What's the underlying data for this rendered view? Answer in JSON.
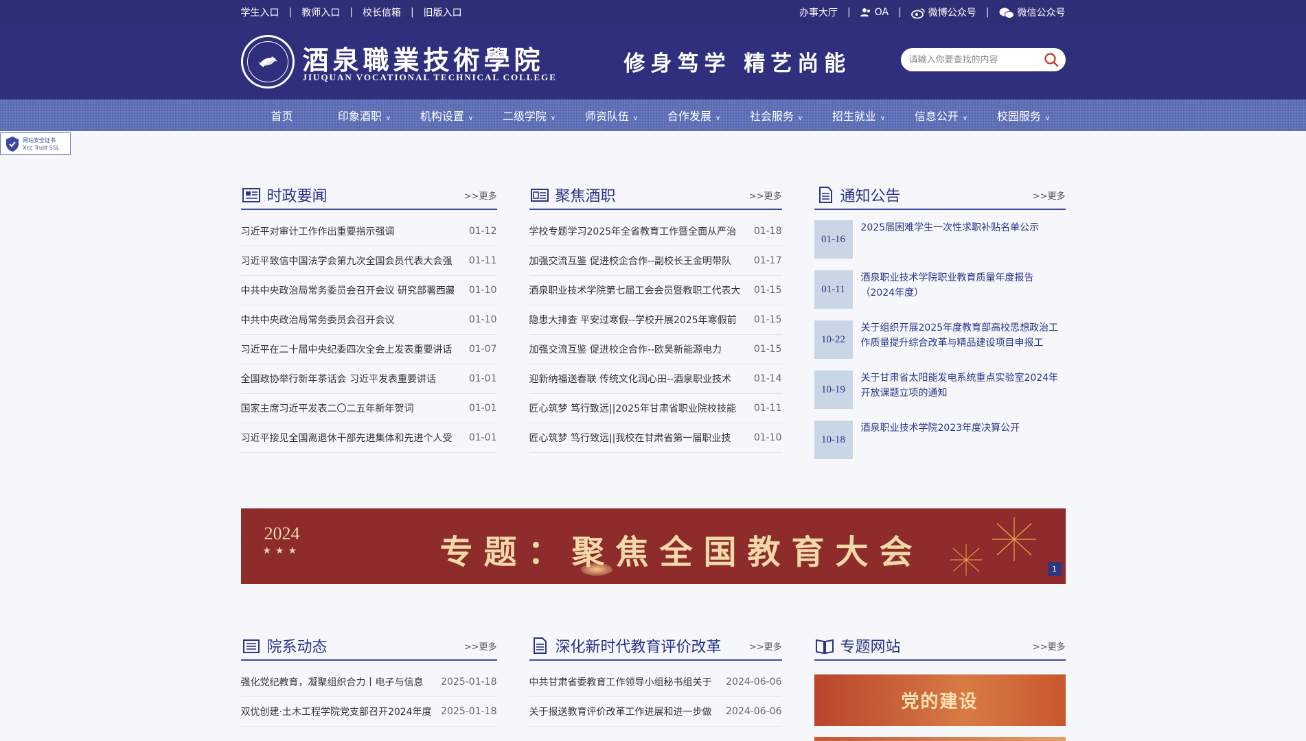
{
  "topbar": {
    "left": [
      "学生入口",
      "教师入口",
      "校长信箱",
      "旧版入口"
    ],
    "right": [
      "办事大厅",
      "OA",
      "微博公众号",
      "微信公众号"
    ]
  },
  "header": {
    "school_cn": "酒泉職業技術學院",
    "school_en": "JIUQUAN VOCATIONAL TECHNICAL COLLEGE",
    "motto": "修身笃学  精艺尚能",
    "search_placeholder": "请输入你要查找的内容"
  },
  "nav": [
    {
      "label": "首页",
      "dropdown": false
    },
    {
      "label": "印象酒职",
      "dropdown": true
    },
    {
      "label": "机构设置",
      "dropdown": true
    },
    {
      "label": "二级学院",
      "dropdown": true
    },
    {
      "label": "师资队伍",
      "dropdown": true
    },
    {
      "label": "合作发展",
      "dropdown": true
    },
    {
      "label": "社会服务",
      "dropdown": true
    },
    {
      "label": "招生就业",
      "dropdown": true
    },
    {
      "label": "信息公开",
      "dropdown": true
    },
    {
      "label": "校园服务",
      "dropdown": true
    }
  ],
  "ssl_badge": {
    "line1": "网站安全证书",
    "line2": "Xcc Trust SSL"
  },
  "more_label": ">>更多",
  "sections": {
    "politics": {
      "title": "时政要闻",
      "items": [
        {
          "title": "习近平对审计工作作出重要指示强调",
          "date": "01-12"
        },
        {
          "title": "习近平致信中国法学会第九次全国会员代表大会强",
          "date": "01-11"
        },
        {
          "title": "中共中央政治局常务委员会召开会议 研究部署西藏",
          "date": "01-10"
        },
        {
          "title": "中共中央政治局常务委员会召开会议",
          "date": "01-10"
        },
        {
          "title": "习近平在二十届中央纪委四次全会上发表重要讲话",
          "date": "01-07"
        },
        {
          "title": "全国政协举行新年茶话会 习近平发表重要讲话",
          "date": "01-01"
        },
        {
          "title": "国家主席习近平发表二〇二五年新年贺词",
          "date": "01-01"
        },
        {
          "title": "习近平接见全国离退休干部先进集体和先进个人受",
          "date": "01-01"
        }
      ]
    },
    "focus": {
      "title": "聚焦酒职",
      "items": [
        {
          "title": "学校专题学习2025年全省教育工作暨全面从严治",
          "date": "01-18"
        },
        {
          "title": "加强交流互鉴 促进校企合作--副校长王金明带队",
          "date": "01-17"
        },
        {
          "title": "酒泉职业技术学院第七届工会会员暨教职工代表大",
          "date": "01-15"
        },
        {
          "title": "隐患大排查 平安过寒假--学校开展2025年寒假前",
          "date": "01-15"
        },
        {
          "title": "加强交流互鉴 促进校企合作--欧昊新能源电力",
          "date": "01-15"
        },
        {
          "title": "迎新纳福送春联 传统文化润心田--酒泉职业技术",
          "date": "01-14"
        },
        {
          "title": "匠心筑梦 笃行致远||2025年甘肃省职业院校技能",
          "date": "01-11"
        },
        {
          "title": "匠心筑梦 笃行致远||我校在甘肃省第一届职业技",
          "date": "01-10"
        }
      ]
    },
    "notices": {
      "title": "通知公告",
      "items": [
        {
          "date": "01-16",
          "title": "2025届困难学生一次性求职补贴名单公示"
        },
        {
          "date": "01-11",
          "title": "酒泉职业技术学院职业教育质量年度报告（2024年度）"
        },
        {
          "date": "10-22",
          "title": "关于组织开展2025年度教育部高校思想政治工作质量提升综合改革与精品建设项目申报工"
        },
        {
          "date": "10-19",
          "title": "关于甘肃省太阳能发电系统重点实验室2024年开放课题立项的通知"
        },
        {
          "date": "10-18",
          "title": "酒泉职业技术学院2023年度决算公开"
        }
      ]
    },
    "departments": {
      "title": "院系动态",
      "items": [
        {
          "title": "强化党纪教育，凝聚组织合力丨电子与信息",
          "date": "2025-01-18"
        },
        {
          "title": "双优创建·土木工程学院党支部召开2024年度",
          "date": "2025-01-18"
        }
      ]
    },
    "reform": {
      "title": "深化新时代教育评价改革",
      "items": [
        {
          "title": "中共甘肃省委教育工作领导小组秘书组关于",
          "date": "2024-06-06"
        },
        {
          "title": "关于报送教育评价改革工作进展和进一步做",
          "date": "2024-06-06"
        }
      ]
    },
    "topics": {
      "title": "专题网站",
      "thumb1_label": "党的建设"
    }
  },
  "banner": {
    "year": "2024",
    "stars": "★★★",
    "headline": "专题：聚焦全国教育大会",
    "page": "1"
  },
  "colors": {
    "topbar_bg": "#2f2f78",
    "header_bg": "#2f2f7e",
    "nav_bg": "#5a6cb4",
    "accent": "#2a3487",
    "banner_bg": "#8e2b2b",
    "notice_date_bg": "#c8d6e6"
  }
}
